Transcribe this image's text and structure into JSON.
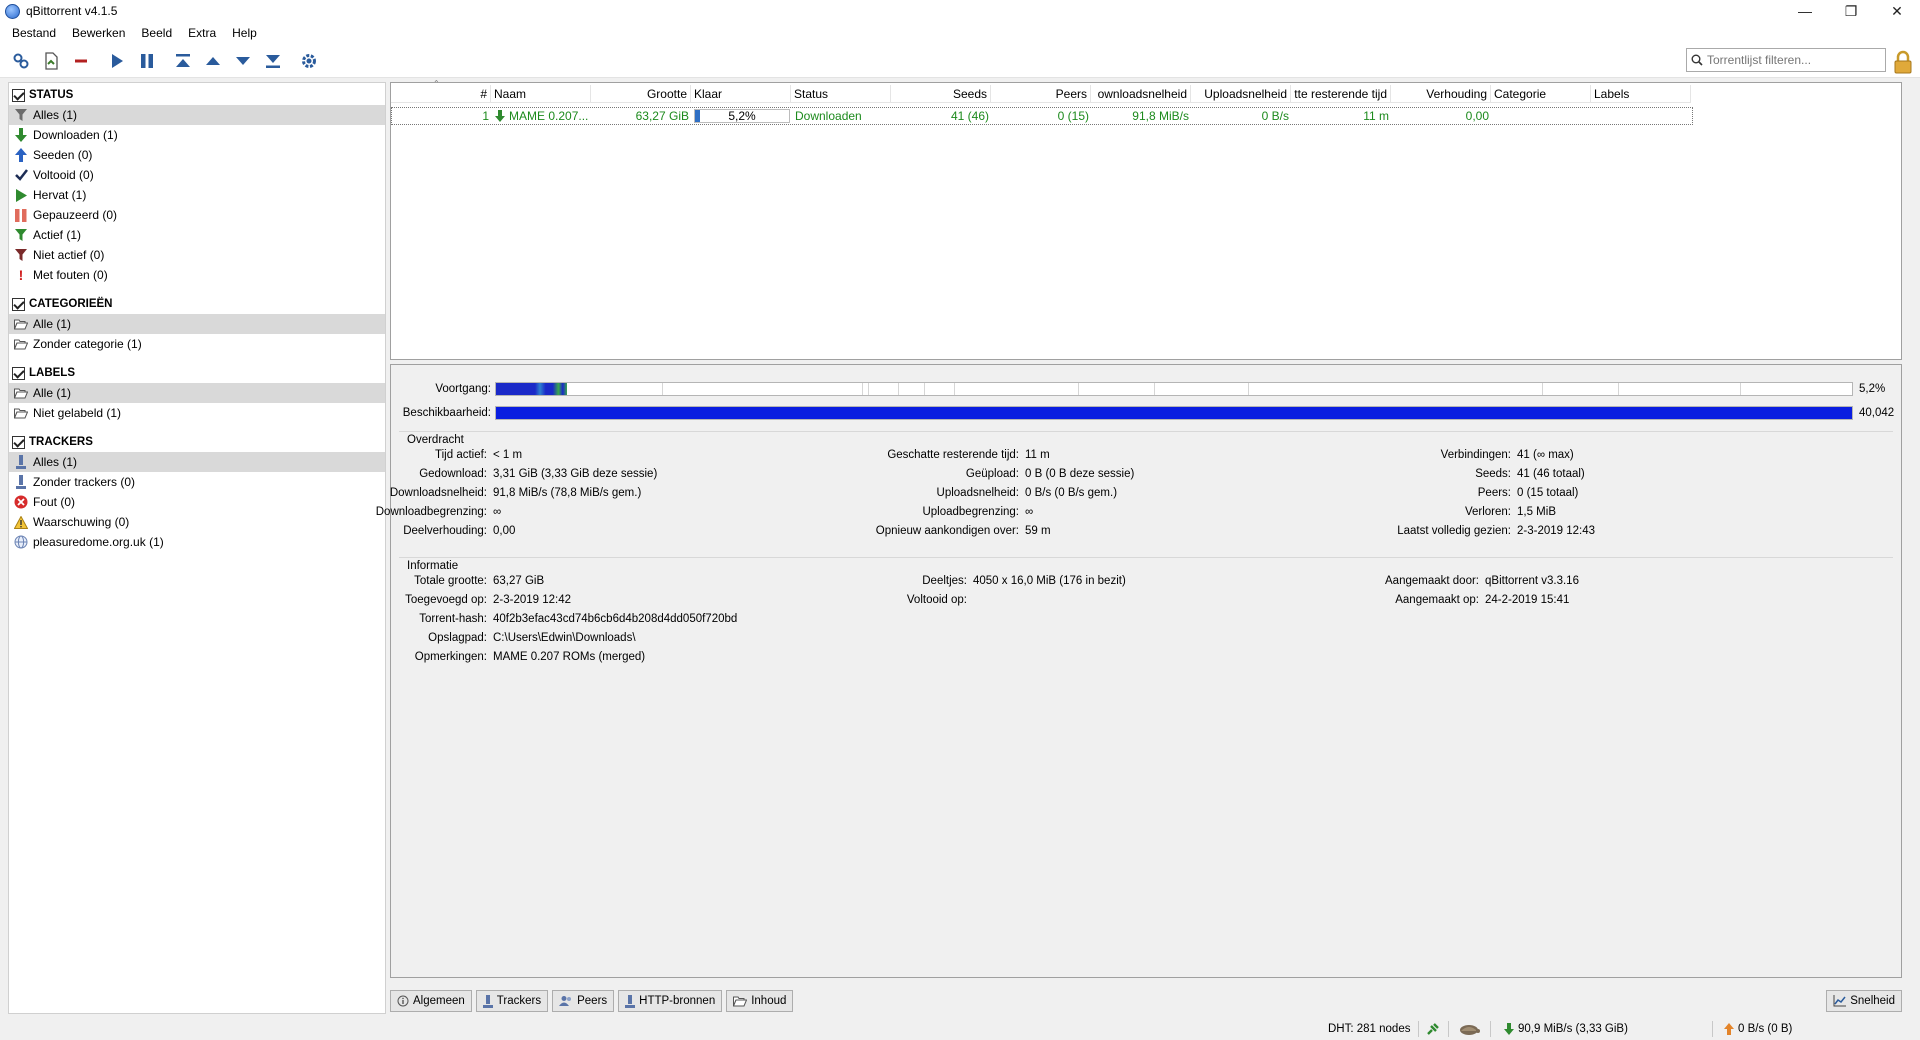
{
  "window": {
    "title": "qBittorrent v4.1.5"
  },
  "menu": [
    "Bestand",
    "Bewerken",
    "Beeld",
    "Extra",
    "Help"
  ],
  "toolbar": {
    "filter_placeholder": "Torrentlijst filteren..."
  },
  "sidebar": {
    "status": {
      "header": "STATUS",
      "items": [
        {
          "label": "Alles (1)",
          "icon": "filter-icon"
        },
        {
          "label": "Downloaden (1)",
          "icon": "arrow-down-icon"
        },
        {
          "label": "Seeden (0)",
          "icon": "arrow-up-icon"
        },
        {
          "label": "Voltooid (0)",
          "icon": "check-icon"
        },
        {
          "label": "Hervat (1)",
          "icon": "play-icon"
        },
        {
          "label": "Gepauzeerd (0)",
          "icon": "pause-icon"
        },
        {
          "label": "Actief (1)",
          "icon": "filter-green-icon"
        },
        {
          "label": "Niet actief (0)",
          "icon": "filter-red-icon"
        },
        {
          "label": "Met fouten (0)",
          "icon": "exclamation-icon"
        }
      ]
    },
    "categories": {
      "header": "CATEGORIEËN",
      "items": [
        {
          "label": "Alle (1)",
          "icon": "folder-open-icon"
        },
        {
          "label": "Zonder categorie (1)",
          "icon": "folder-open-icon"
        }
      ]
    },
    "labels": {
      "header": "LABELS",
      "items": [
        {
          "label": "Alle (1)",
          "icon": "folder-open-icon"
        },
        {
          "label": "Niet gelabeld (1)",
          "icon": "folder-open-icon"
        }
      ]
    },
    "trackers": {
      "header": "TRACKERS",
      "items": [
        {
          "label": "Alles (1)",
          "icon": "tracker-icon"
        },
        {
          "label": "Zonder trackers (0)",
          "icon": "tracker-icon"
        },
        {
          "label": "Fout (0)",
          "icon": "error-icon"
        },
        {
          "label": "Waarschuwing (0)",
          "icon": "warning-icon"
        },
        {
          "label": "pleasuredome.org.uk (1)",
          "icon": "globe-icon"
        }
      ]
    }
  },
  "table": {
    "columns": [
      "#",
      "Naam",
      "Grootte",
      "Klaar",
      "Status",
      "Seeds",
      "Peers",
      "ownloadsnelheid",
      "Uploadsnelheid",
      "tte resterende tijd",
      "Verhouding",
      "Categorie",
      "Labels"
    ],
    "rows": [
      {
        "num": "1",
        "name": "MAME 0.207...",
        "size": "63,27 GiB",
        "progress_text": "5,2%",
        "progress": 0.052,
        "status": "Downloaden",
        "seeds": "41 (46)",
        "peers": "0 (15)",
        "down": "91,8 MiB/s",
        "up": "0 B/s",
        "eta": "11 m",
        "ratio": "0,00",
        "category": "",
        "labels": ""
      }
    ]
  },
  "details": {
    "progress_label": "Voortgang:",
    "progress_value": "5,2%",
    "progress": 0.052,
    "availability_label": "Beschikbaarheid:",
    "availability_value": "40,042",
    "transfer": {
      "title": "Overdracht",
      "col1": [
        {
          "k": "Tijd actief:",
          "v": "< 1 m"
        },
        {
          "k": "Gedownload:",
          "v": "3,31 GiB (3,33 GiB deze sessie)"
        },
        {
          "k": "Downloadsnelheid:",
          "v": "91,8 MiB/s (78,8 MiB/s gem.)"
        },
        {
          "k": "Downloadbegrenzing:",
          "v": "∞"
        },
        {
          "k": "Deelverhouding:",
          "v": "0,00"
        }
      ],
      "col2": [
        {
          "k": "Geschatte resterende tijd:",
          "v": "11 m"
        },
        {
          "k": "Geüpload:",
          "v": "0 B (0 B deze sessie)"
        },
        {
          "k": "Uploadsnelheid:",
          "v": "0 B/s (0 B/s gem.)"
        },
        {
          "k": "Uploadbegrenzing:",
          "v": "∞"
        },
        {
          "k": "Opnieuw aankondigen over:",
          "v": "59 m"
        }
      ],
      "col3": [
        {
          "k": "Verbindingen:",
          "v": "41 (∞ max)"
        },
        {
          "k": "Seeds:",
          "v": "41 (46 totaal)"
        },
        {
          "k": "Peers:",
          "v": "0 (15 totaal)"
        },
        {
          "k": "Verloren:",
          "v": "1,5 MiB"
        },
        {
          "k": "Laatst volledig gezien:",
          "v": "2-3-2019 12:43"
        }
      ]
    },
    "info": {
      "title": "Informatie",
      "col1": [
        {
          "k": "Totale grootte:",
          "v": "63,27 GiB"
        },
        {
          "k": "Toegevoegd op:",
          "v": "2-3-2019 12:42"
        },
        {
          "k": "Torrent-hash:",
          "v": "40f2b3efac43cd74b6cb6d4b208d4dd050f720bd"
        },
        {
          "k": "Opslagpad:",
          "v": "C:\\Users\\Edwin\\Downloads\\"
        },
        {
          "k": "Opmerkingen:",
          "v": "MAME 0.207 ROMs (merged)"
        }
      ],
      "col2": [
        {
          "k": "Deeltjes:",
          "v": "4050 x 16,0 MiB (176 in bezit)"
        },
        {
          "k": "Voltooid op:",
          "v": ""
        }
      ],
      "col3": [
        {
          "k": "Aangemaakt door:",
          "v": "qBittorrent v3.3.16"
        },
        {
          "k": "Aangemaakt op:",
          "v": "24-2-2019 15:41"
        }
      ]
    }
  },
  "tabs": [
    "Algemeen",
    "Trackers",
    "Peers",
    "HTTP-bronnen",
    "Inhoud"
  ],
  "speed_tab": "Snelheid",
  "statusbar": {
    "dht": "DHT: 281 nodes",
    "down": "90,9 MiB/s (3,33 GiB)",
    "up": "0 B/s (0 B)"
  }
}
